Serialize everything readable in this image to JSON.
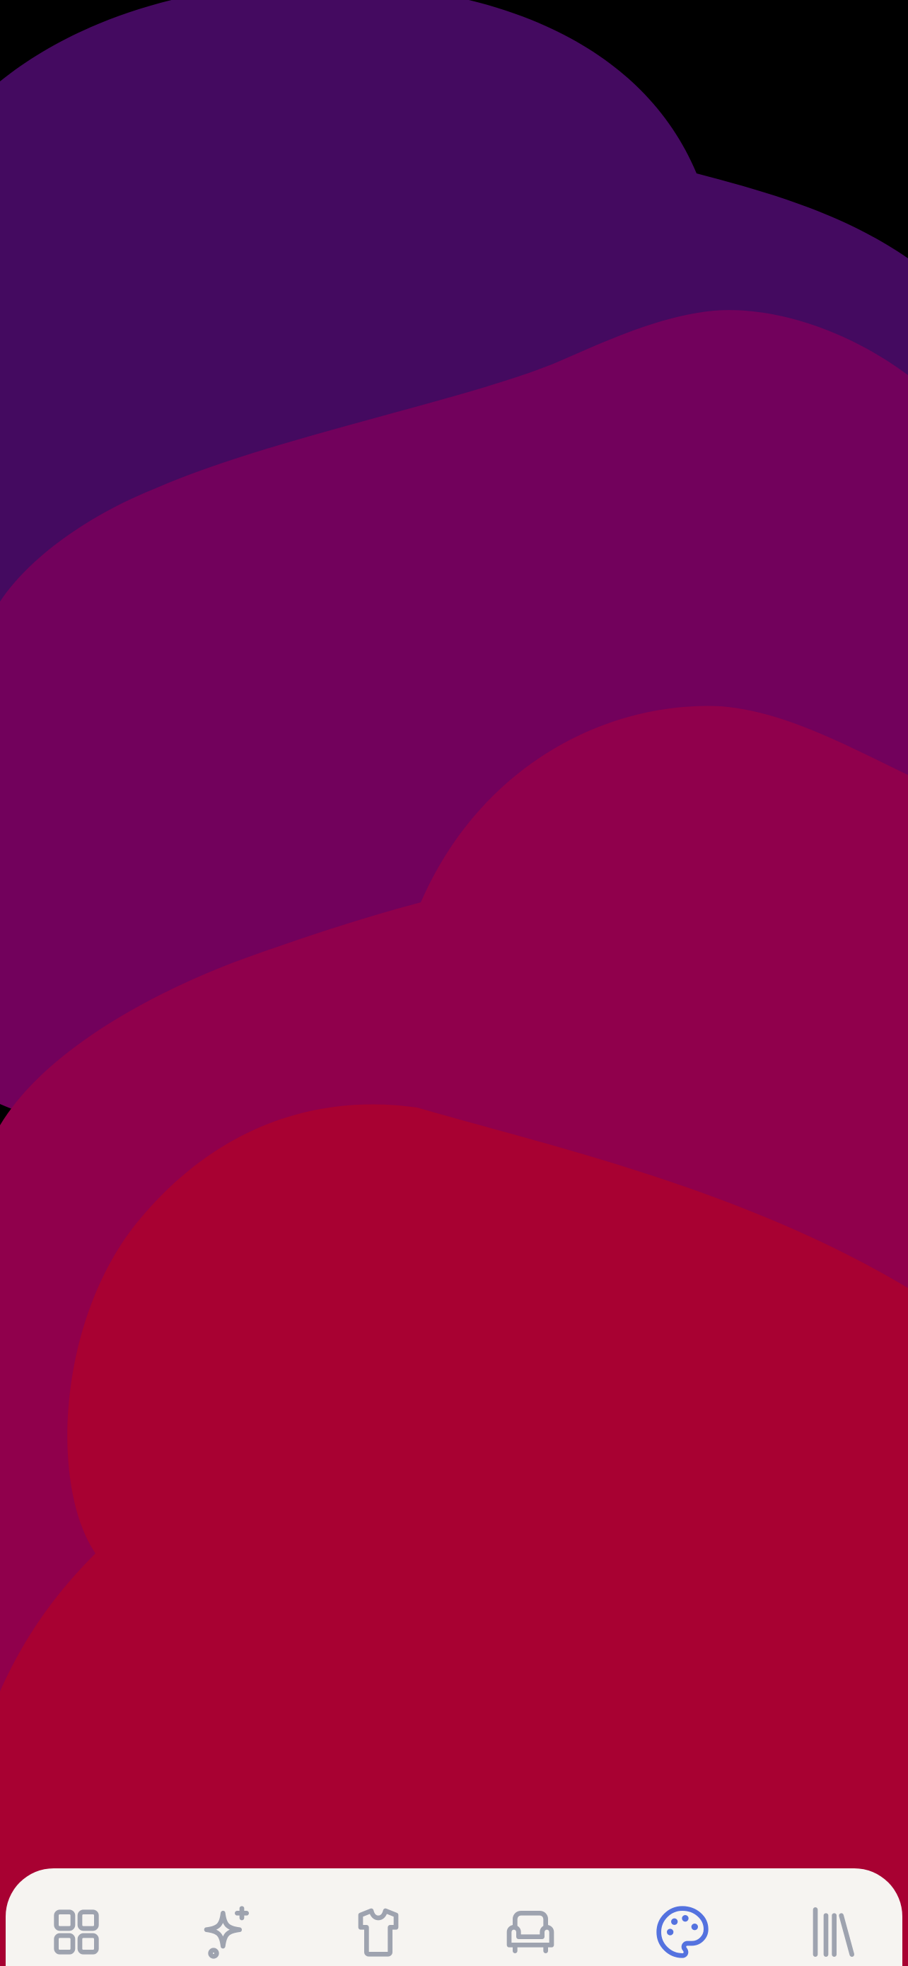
{
  "wallpaper": {
    "background": "#000000",
    "bands": [
      {
        "name": "indigo",
        "color": "#440a60"
      },
      {
        "name": "plum",
        "color": "#72015c"
      },
      {
        "name": "magenta",
        "color": "#90004c"
      },
      {
        "name": "crimson",
        "color": "#a80132"
      }
    ]
  },
  "tab_bar": {
    "background": "#f6f4f1",
    "inactive_color": "#9ea3af",
    "active_color": "#5472df",
    "active_tab": "palette",
    "tabs": [
      {
        "id": "grid",
        "icon": "grid-icon"
      },
      {
        "id": "sparkles",
        "icon": "sparkles-icon"
      },
      {
        "id": "shirt",
        "icon": "shirt-icon"
      },
      {
        "id": "armchair",
        "icon": "armchair-icon"
      },
      {
        "id": "palette",
        "icon": "palette-icon"
      },
      {
        "id": "library",
        "icon": "library-icon"
      }
    ]
  }
}
